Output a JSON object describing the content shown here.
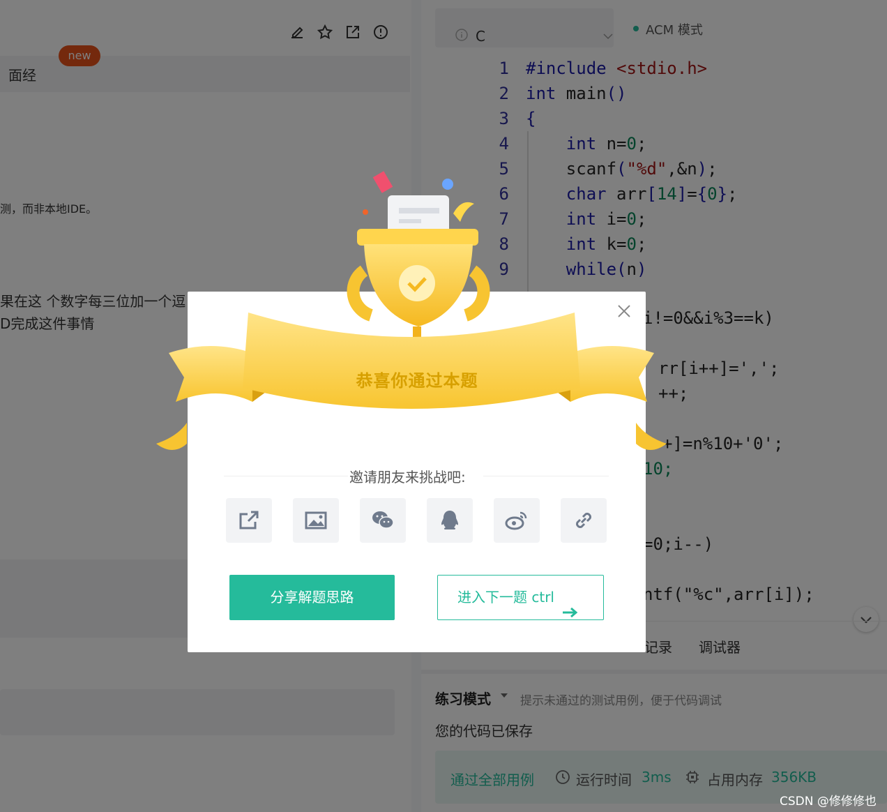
{
  "left_panel": {
    "tab_label": "面经",
    "new_badge": "new",
    "text_line_1": "测，而非本地IDE。",
    "text_line_2": "果在这 个数字每三位加一个逗",
    "text_line_3": "D完成这件事情"
  },
  "toolbar_icons": [
    "edit-icon",
    "star-icon",
    "share-out-icon",
    "report-icon"
  ],
  "editor": {
    "language": "C",
    "mode": "ACM 模式",
    "code_lines": [
      {
        "n": "1",
        "t": "#include <stdio.h>"
      },
      {
        "n": "2",
        "t": "int main()"
      },
      {
        "n": "3",
        "t": "{"
      },
      {
        "n": "4",
        "t": "    int n=0;"
      },
      {
        "n": "5",
        "t": "    scanf(\"%d\",&n);"
      },
      {
        "n": "6",
        "t": "    char arr[14]={0};"
      },
      {
        "n": "7",
        "t": "    int i=0;"
      },
      {
        "n": "8",
        "t": "    int k=0;"
      },
      {
        "n": "9",
        "t": "    while(n)"
      }
    ],
    "hidden_fragments": [
      "i!=0&&i%3==k)",
      "rr[i++]=',';",
      "++;",
      "+]=n%10+'0';",
      "10;",
      "=0;i--)",
      "ntf(\"%c\",arr[i]);"
    ]
  },
  "bottom_tabs": {
    "tab_record": "记录",
    "tab_debugger": "调试器"
  },
  "practice": {
    "mode_label": "练习模式",
    "hint": "提示未通过的测试用例，便于代码调试",
    "saved": "您的代码已保存"
  },
  "result": {
    "passed": "通过全部用例",
    "time_label": "运行时间",
    "time_value": "3ms",
    "memory_label": "占用内存",
    "memory_value": "356KB"
  },
  "modal": {
    "title": "恭喜你通过本题",
    "invite": "邀请朋友来挑战吧:",
    "share_icons": [
      "external-share-icon",
      "image-icon",
      "wechat-icon",
      "qq-icon",
      "weibo-icon",
      "link-icon"
    ],
    "share_solution_button": "分享解题思路",
    "next_button": "进入下一题 ctrl"
  },
  "watermark": "CSDN @修修修也",
  "colors": {
    "accent": "#25bb9b",
    "badge": "#e8521a",
    "trophy": "#f7c431",
    "title": "#d7a000"
  }
}
